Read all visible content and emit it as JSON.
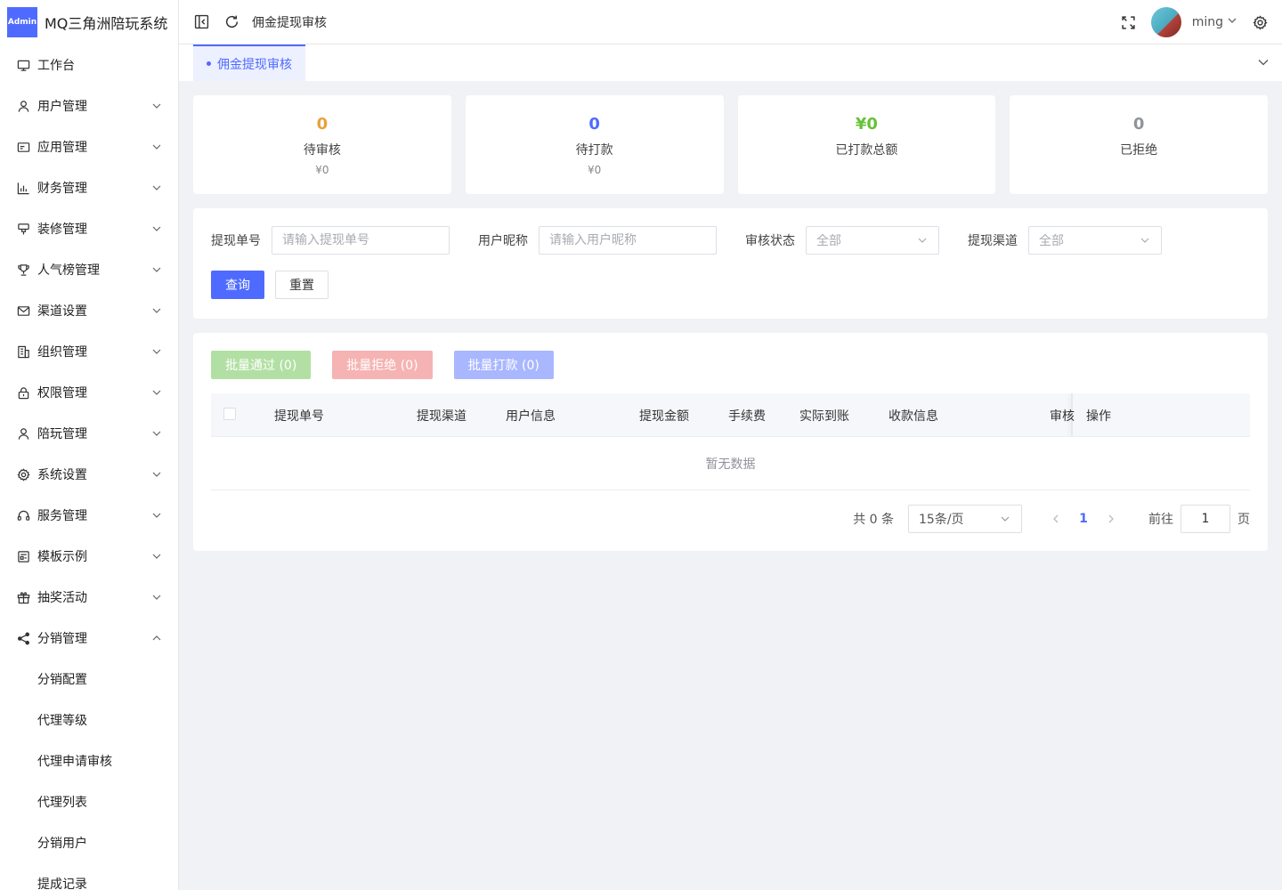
{
  "app": {
    "badge": "Admin",
    "title": "MQ三角洲陪玩系统"
  },
  "sidebar": {
    "items": [
      {
        "label": "工作台",
        "icon": "monitor-icon",
        "arrow": ""
      },
      {
        "label": "用户管理",
        "icon": "user-icon",
        "arrow": "down"
      },
      {
        "label": "应用管理",
        "icon": "app-card-icon",
        "arrow": "down"
      },
      {
        "label": "财务管理",
        "icon": "chart-icon",
        "arrow": "down"
      },
      {
        "label": "装修管理",
        "icon": "brush-icon",
        "arrow": "down"
      },
      {
        "label": "人气榜管理",
        "icon": "trophy-icon",
        "arrow": "down"
      },
      {
        "label": "渠道设置",
        "icon": "mail-icon",
        "arrow": "down"
      },
      {
        "label": "组织管理",
        "icon": "building-icon",
        "arrow": "down"
      },
      {
        "label": "权限管理",
        "icon": "lock-icon",
        "arrow": "down"
      },
      {
        "label": "陪玩管理",
        "icon": "user-icon",
        "arrow": "down"
      },
      {
        "label": "系统设置",
        "icon": "gear-icon",
        "arrow": "down"
      },
      {
        "label": "服务管理",
        "icon": "headset-icon",
        "arrow": "down"
      },
      {
        "label": "模板示例",
        "icon": "template-icon",
        "arrow": "down"
      },
      {
        "label": "抽奖活动",
        "icon": "gift-icon",
        "arrow": "down"
      },
      {
        "label": "分销管理",
        "icon": "share-icon",
        "arrow": "up"
      }
    ],
    "subitems": [
      {
        "label": "分销配置"
      },
      {
        "label": "代理等级"
      },
      {
        "label": "代理申请审核"
      },
      {
        "label": "代理列表"
      },
      {
        "label": "分销用户"
      },
      {
        "label": "提成记录"
      }
    ]
  },
  "header": {
    "breadcrumb": "佣金提现审核",
    "username": "ming"
  },
  "tabs": {
    "active": "佣金提现审核"
  },
  "stats": [
    {
      "value": "0",
      "label": "待审核",
      "sub": "¥0",
      "color": "#e6a23c"
    },
    {
      "value": "0",
      "label": "待打款",
      "sub": "¥0",
      "color": "#4f6bff"
    },
    {
      "value": "¥0",
      "label": "已打款总额",
      "sub": "",
      "color": "#67c23a"
    },
    {
      "value": "0",
      "label": "已拒绝",
      "sub": "",
      "color": "#909399"
    }
  ],
  "filters": {
    "order_no_label": "提现单号",
    "order_no_placeholder": "请输入提现单号",
    "nickname_label": "用户昵称",
    "nickname_placeholder": "请输入用户昵称",
    "status_label": "审核状态",
    "status_value": "全部",
    "channel_label": "提现渠道",
    "channel_value": "全部",
    "query_label": "查询",
    "reset_label": "重置"
  },
  "batch": {
    "approve": "批量通过 (0)",
    "reject": "批量拒绝 (0)",
    "pay": "批量打款 (0)"
  },
  "table": {
    "columns": [
      "提现单号",
      "提现渠道",
      "用户信息",
      "提现金额",
      "手续费",
      "实际到账",
      "收款信息",
      "审核",
      "操作"
    ],
    "empty_text": "暂无数据"
  },
  "pagination": {
    "total": "共 0 条",
    "page_size": "15条/页",
    "current_page": "1",
    "goto_label": "前往",
    "goto_value": "1",
    "page_suffix": "页"
  }
}
